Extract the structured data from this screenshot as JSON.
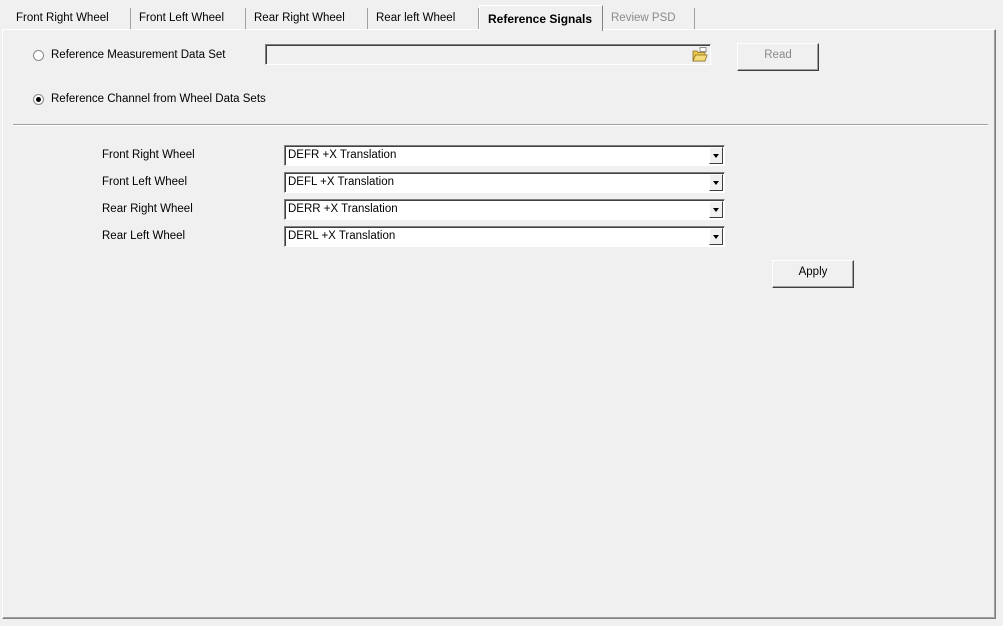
{
  "tabs": [
    {
      "label": "Front Right Wheel",
      "state": "normal"
    },
    {
      "label": "Front Left Wheel",
      "state": "normal"
    },
    {
      "label": "Rear Right Wheel",
      "state": "normal"
    },
    {
      "label": "Rear left Wheel",
      "state": "normal"
    },
    {
      "label": "Reference Signals",
      "state": "active"
    },
    {
      "label": "Review PSD",
      "state": "disabled"
    }
  ],
  "source": {
    "option_measurement": {
      "label": "Reference Measurement Data Set",
      "selected": false
    },
    "file_path": {
      "value": "",
      "icon": "folder-open-icon"
    },
    "read_button": {
      "label": "Read",
      "enabled": false
    },
    "option_channel": {
      "label": "Reference Channel from Wheel Data Sets",
      "selected": true
    }
  },
  "channels": [
    {
      "label": "Front Right Wheel",
      "value": "DEFR +X Translation"
    },
    {
      "label": "Front Left Wheel",
      "value": "DEFL +X Translation"
    },
    {
      "label": "Rear Right Wheel",
      "value": "DERR +X Translation"
    },
    {
      "label": "Rear Left Wheel",
      "value": "DERL +X Translation"
    }
  ],
  "apply_button": {
    "label": "Apply"
  }
}
